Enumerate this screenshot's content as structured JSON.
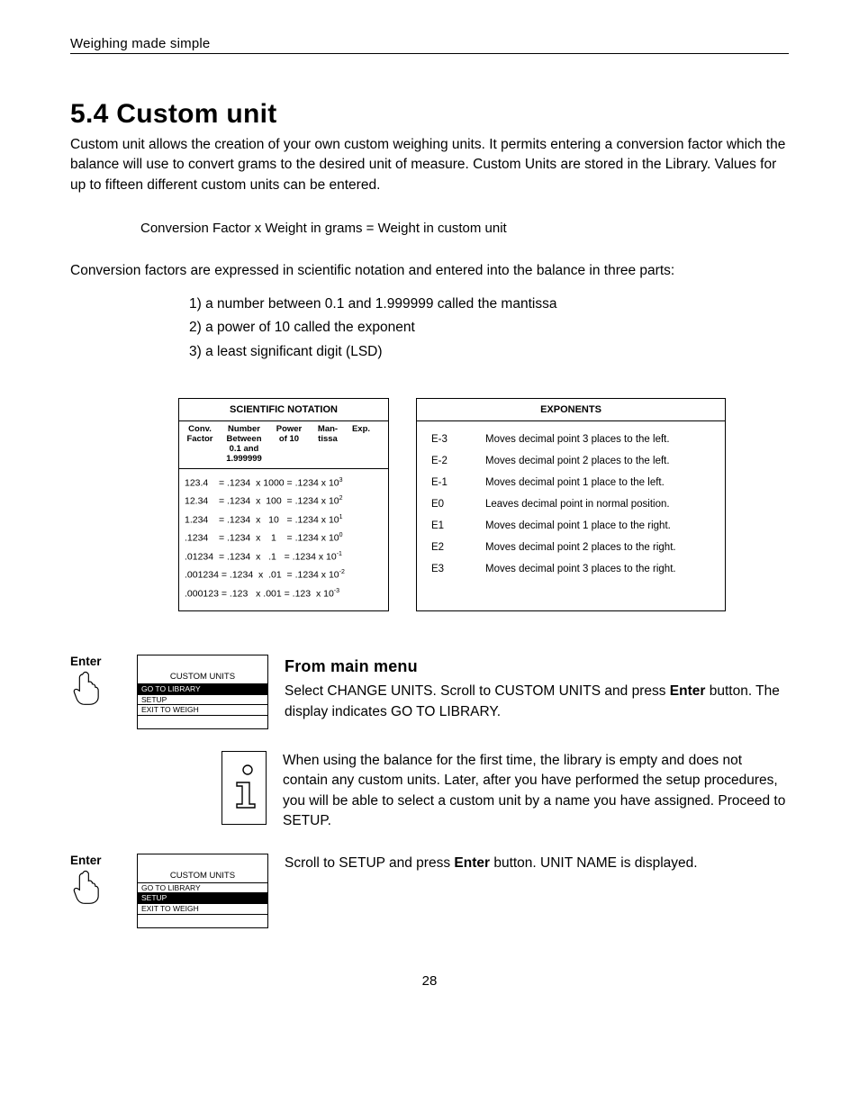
{
  "header": "Weighing made simple",
  "section_title": "5.4  Custom unit",
  "intro": "Custom unit allows the creation of your own custom weighing units.  It permits entering a conversion factor which the balance will use to convert grams to the desired unit of measure.  Custom Units are stored in the Library.  Values for up to fifteen different custom units can be entered.",
  "formula": "Conversion Factor x Weight in grams = Weight in custom unit",
  "parts_intro": "Conversion factors are expressed in scientific notation and entered into the balance in three parts:",
  "parts": [
    "1) a number between 0.1 and 1.999999 called the mantissa",
    "2) a power of 10 called the exponent",
    "3) a least significant digit (LSD)"
  ],
  "sci_table": {
    "title": "SCIENTIFIC  NOTATION",
    "headers": {
      "c1": "Conv.\nFactor",
      "c2": "Number\nBetween\n0.1 and\n1.999999",
      "c3": "Power\nof 10",
      "c4": "Man-\ntissa",
      "c5": "Exp."
    },
    "rows_html": [
      "123.4&nbsp;&nbsp;&nbsp;&nbsp;= .1234 &nbsp;x&nbsp;1000 = .1234 x 10<sup>3</sup>",
      "12.34&nbsp;&nbsp;&nbsp;&nbsp;= .1234 &nbsp;x&nbsp;&nbsp;100 &nbsp;= .1234 x 10<sup>2</sup>",
      "1.234&nbsp;&nbsp;&nbsp;&nbsp;= .1234 &nbsp;x&nbsp;&nbsp;&nbsp;10 &nbsp;&nbsp;= .1234 x 10<sup>1</sup>",
      ".1234&nbsp;&nbsp;&nbsp;&nbsp;= .1234 &nbsp;x&nbsp;&nbsp;&nbsp;&nbsp;1 &nbsp;&nbsp;&nbsp;= .1234 x 10<sup>0</sup>",
      ".01234 &nbsp;= .1234 &nbsp;x&nbsp;&nbsp;&nbsp;.1 &nbsp;&nbsp;= .1234 x 10<sup>-1</sup>",
      ".001234 = .1234 &nbsp;x&nbsp;&nbsp;.01 &nbsp;= .1234 x 10<sup>-2</sup>",
      ".000123 = .123 &nbsp;&nbsp;x&nbsp;.001 = .123 &nbsp;x 10<sup>-3</sup>"
    ]
  },
  "exp_table": {
    "title": "EXPONENTS",
    "rows": [
      {
        "code": "E-3",
        "desc": "Moves decimal point 3 places to the left."
      },
      {
        "code": "E-2",
        "desc": "Moves decimal point 2 places to the left."
      },
      {
        "code": "E-1",
        "desc": "Moves decimal point 1 place to the left."
      },
      {
        "code": "E0",
        "desc": "Leaves decimal point in normal position."
      },
      {
        "code": "E1",
        "desc": "Moves decimal point 1 place to the right."
      },
      {
        "code": "E2",
        "desc": "Moves decimal point 2 places to the right."
      },
      {
        "code": "E3",
        "desc": "Moves decimal point 3 places to the right."
      }
    ]
  },
  "enter_label": "Enter",
  "screen1": {
    "title": "CUSTOM UNITS",
    "lines": [
      "GO TO LIBRARY",
      "SETUP",
      "EXIT TO WEIGH"
    ],
    "highlight": 0
  },
  "screen2": {
    "title": "CUSTOM UNITS",
    "lines": [
      "GO TO LIBRARY",
      "SETUP",
      "EXIT TO WEIGH"
    ],
    "highlight": 1
  },
  "subheading": "From main menu",
  "step1_pre": "Select CHANGE UNITS.  Scroll to CUSTOM UNITS and press ",
  "step1_bold": "Enter",
  "step1_post": " button.  The display indicates GO TO LIBRARY.",
  "step2": "When using the balance for the first time, the library is empty and does not contain any custom units.  Later, after you have performed the setup procedures, you will be able to select a custom unit by a name you have assigned.  Proceed to SETUP.",
  "step3_pre": "Scroll to SETUP and press ",
  "step3_bold": "Enter",
  "step3_post": " button.  UNIT NAME is displayed.",
  "page_number": "28"
}
